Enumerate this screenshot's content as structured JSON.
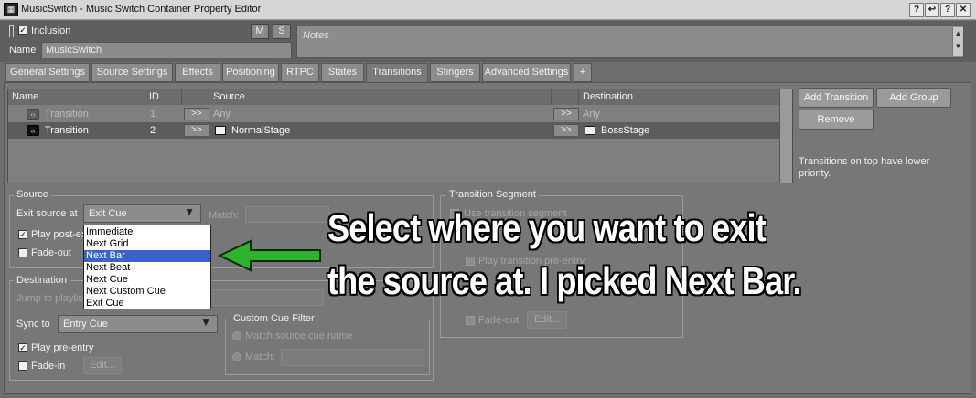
{
  "window": {
    "title": "MusicSwitch - Music Switch Container Property Editor",
    "app_icon": "wwise-icon",
    "controls": [
      "?",
      "↩",
      "?",
      "✕"
    ]
  },
  "header": {
    "inclusion_label": "Inclusion",
    "inclusion_checked": true,
    "m_label": "M",
    "s_label": "S",
    "name_label": "Name",
    "name_value": "MusicSwitch",
    "notes_placeholder": "Notes"
  },
  "tabs": [
    {
      "label": "General Settings"
    },
    {
      "label": "Source Settings"
    },
    {
      "label": "Effects"
    },
    {
      "label": "Positioning"
    },
    {
      "label": "RTPC"
    },
    {
      "label": "States"
    },
    {
      "label": "Transitions",
      "active": true
    },
    {
      "label": "Stingers"
    },
    {
      "label": "Advanced Settings"
    },
    {
      "label": "+"
    }
  ],
  "transitions_table": {
    "columns": [
      "Name",
      "ID",
      "",
      "Source",
      "",
      "Destination"
    ],
    "rows": [
      {
        "name": "Transition",
        "id": "1",
        "arrow": ">>",
        "source": "Any",
        "arrow2": ">>",
        "destination": "Any",
        "enabled": false
      },
      {
        "name": "Transition",
        "id": "2",
        "arrow": ">>",
        "source": "NormalStage",
        "arrow2": ">>",
        "destination": "BossStage",
        "enabled": true
      }
    ]
  },
  "side_buttons": {
    "add_transition": "Add Transition",
    "add_group": "Add Group",
    "remove": "Remove",
    "hint": "Transitions on top have lower priority."
  },
  "source_group": {
    "title": "Source",
    "exit_source_label": "Exit source at",
    "exit_source_value": "Exit Cue",
    "match_label": "Match:",
    "play_post_exit": "Play post-exit",
    "fade_out": "Fade-out",
    "dropdown_options": [
      "Immediate",
      "Next Grid",
      "Next Bar",
      "Next Beat",
      "Next Cue",
      "Next Custom Cue",
      "Exit Cue"
    ],
    "dropdown_selected": "Next Bar"
  },
  "destination_group": {
    "title": "Destination",
    "jump_to_playlist": "Jump to playlist item",
    "sync_to_label": "Sync to",
    "sync_to_value": "Entry Cue",
    "play_pre_entry": "Play pre-entry",
    "fade_in": "Fade-in",
    "edit": "Edit...",
    "custom_cue_filter": {
      "title": "Custom Cue Filter",
      "match_source": "Match source cue name",
      "match_label": "Match:"
    }
  },
  "transition_segment": {
    "title": "Transition Segment",
    "use_segment": "Use transition segment",
    "play_entry": "Play transition pre-entry",
    "fade_out": "Fade-out",
    "edit": "Edit..."
  },
  "annotation": {
    "line1": "Select where you want to exit",
    "line2": "the source at.  I picked Next Bar.",
    "arrow_color": "#2fb32f"
  }
}
